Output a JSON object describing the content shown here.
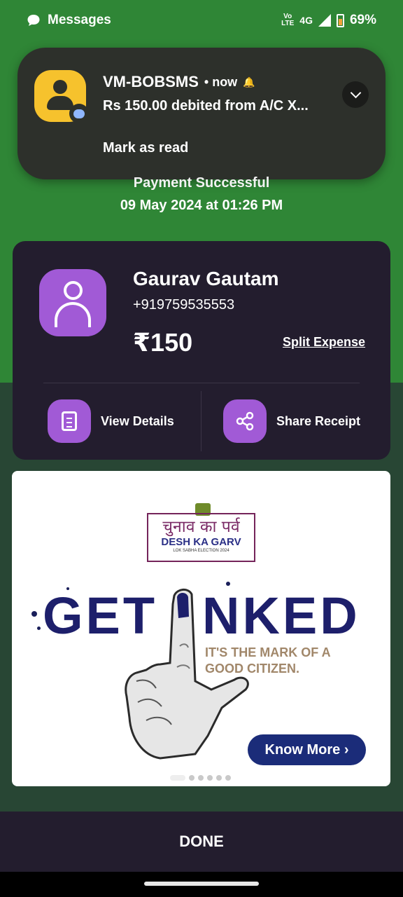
{
  "status_bar": {
    "app_name": "Messages",
    "volte": "Vo\nLTE",
    "network": "4G",
    "battery": "69%"
  },
  "notification": {
    "sender": "VM-BOBSMS",
    "time": "• now",
    "message": "Rs 150.00 debited from A/C X...",
    "action": "Mark as read",
    "icons": [
      "contact-avatar-icon",
      "message-badge-icon",
      "silent-bell-icon",
      "chevron-down-icon"
    ]
  },
  "payment": {
    "status": "Payment Successful",
    "date": "09 May 2024 at 01:26 PM"
  },
  "payee": {
    "name": "Gaurav Gautam",
    "phone": "+919759535553",
    "amount": "₹150",
    "split_label": "Split Expense"
  },
  "actions": {
    "view_details": "View Details",
    "share_receipt": "Share Receipt"
  },
  "banner": {
    "logo_hindi": "चुनाव का पर्व",
    "logo_english": "DESH KA GARV",
    "logo_sub": "LOK SABHA ELECTION 2024",
    "headline_left": "GET",
    "headline_right": "NKED",
    "tagline_line1": "IT'S THE MARK OF A",
    "tagline_line2": "GOOD CITIZEN.",
    "cta": "Know More ›",
    "slide_count": 6,
    "active_slide": 1
  },
  "footer": {
    "done_label": "DONE"
  },
  "colors": {
    "header_green": "#2f8636",
    "body_green": "#284634",
    "card_bg": "#231d2e",
    "accent_purple": "#a15ad6",
    "banner_navy": "#1d1f6b"
  }
}
